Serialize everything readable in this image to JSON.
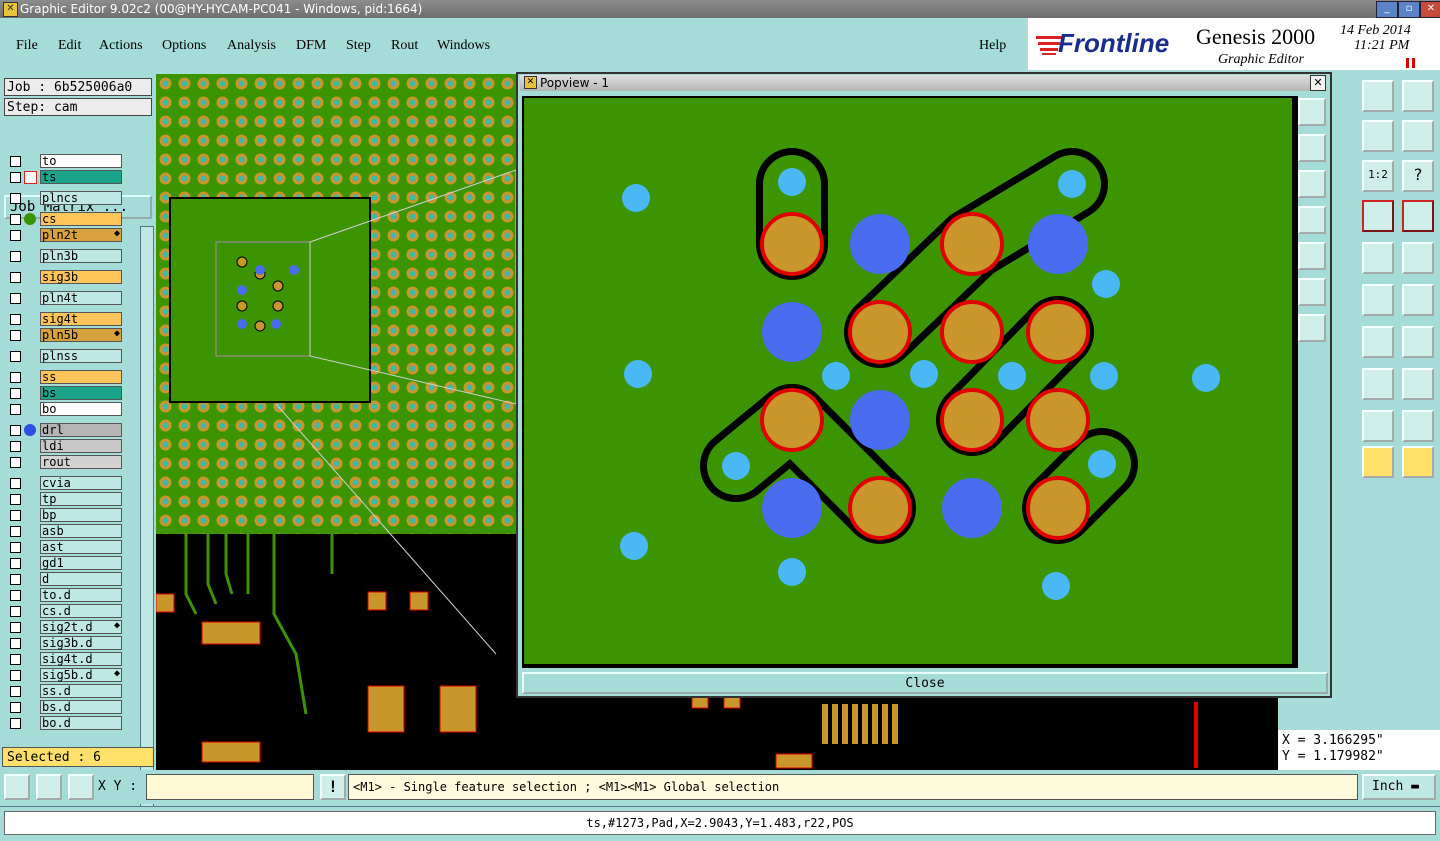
{
  "window": {
    "title": "Graphic Editor 9.02c2 (00@HY-HYCAM-PC041 - Windows, pid:1664)"
  },
  "menu": [
    "File",
    "Edit",
    "Actions",
    "Options",
    "Analysis",
    "DFM",
    "Step",
    "Rout",
    "Windows"
  ],
  "help_label": "Help",
  "brand": {
    "logo": "Frontline",
    "product": "Genesis 2000",
    "subtitle": "Graphic Editor",
    "date": "14 Feb 2014",
    "time": "11:21 PM"
  },
  "job": {
    "label": "Job : 6b525006a0",
    "step": "Step: cam",
    "matrix_button": "Job Matrix ..."
  },
  "layers": [
    {
      "name": "to",
      "color": "#ffffff"
    },
    {
      "name": "ts",
      "color": "#1ba58c",
      "active": true
    },
    {
      "name": "plncs",
      "color": "#bfe8e4"
    },
    {
      "name": "cs",
      "color": "#fec65a",
      "indicator": "green"
    },
    {
      "name": "pln2t",
      "color": "#d7a23e",
      "lock": true
    },
    {
      "name": "pln3b",
      "color": "#bfe8e4"
    },
    {
      "name": "sig3b",
      "color": "#fec65a"
    },
    {
      "name": "pln4t",
      "color": "#bfe8e4"
    },
    {
      "name": "sig4t",
      "color": "#fec65a"
    },
    {
      "name": "pln5b",
      "color": "#d7a23e",
      "lock": true
    },
    {
      "name": "plnss",
      "color": "#bfe8e4"
    },
    {
      "name": "ss",
      "color": "#fec65a"
    },
    {
      "name": "bs",
      "color": "#1ba58c"
    },
    {
      "name": "bo",
      "color": "#ffffff"
    },
    {
      "name": "drl",
      "color": "#b4b4b4",
      "indicator": "blue"
    },
    {
      "name": "ldi",
      "color": "#c8c8c8"
    },
    {
      "name": "rout",
      "color": "#d2d2d2"
    },
    {
      "name": "cvia",
      "color": "#bfe8e4"
    },
    {
      "name": "tp",
      "color": "#bfe8e4"
    },
    {
      "name": "bp",
      "color": "#bfe8e4"
    },
    {
      "name": "asb",
      "color": "#bfe8e4"
    },
    {
      "name": "ast",
      "color": "#bfe8e4"
    },
    {
      "name": "gd1",
      "color": "#bfe8e4"
    },
    {
      "name": "d",
      "color": "#bfe8e4"
    },
    {
      "name": "to.d",
      "color": "#bfe8e4"
    },
    {
      "name": "cs.d",
      "color": "#bfe8e4"
    },
    {
      "name": "sig2t.d",
      "color": "#bfe8e4",
      "lock": true
    },
    {
      "name": "sig3b.d",
      "color": "#bfe8e4"
    },
    {
      "name": "sig4t.d",
      "color": "#bfe8e4"
    },
    {
      "name": "sig5b.d",
      "color": "#bfe8e4",
      "lock": true
    },
    {
      "name": "ss.d",
      "color": "#bfe8e4"
    },
    {
      "name": "bs.d",
      "color": "#bfe8e4"
    },
    {
      "name": "bo.d",
      "color": "#bfe8e4"
    }
  ],
  "selected": "Selected : 6",
  "popview": {
    "title": "Popview - 1",
    "close_label": "Close"
  },
  "coords": {
    "x": "X = 3.166295\"",
    "y": "Y = 1.179982\""
  },
  "xy_label": "X Y :",
  "hint": "<M1> - Single feature selection ; <M1><M1> Global selection",
  "unit": "Inch",
  "status": "ts,#1273,Pad,X=2.9043,Y=1.483,r22,POS",
  "colors": {
    "panel": "#a6dcd7",
    "board": "#3c9400",
    "pad": "#c89a1a",
    "drill": "#4a6cf0",
    "via": "#4ab8f4",
    "outline": "#e00000"
  }
}
